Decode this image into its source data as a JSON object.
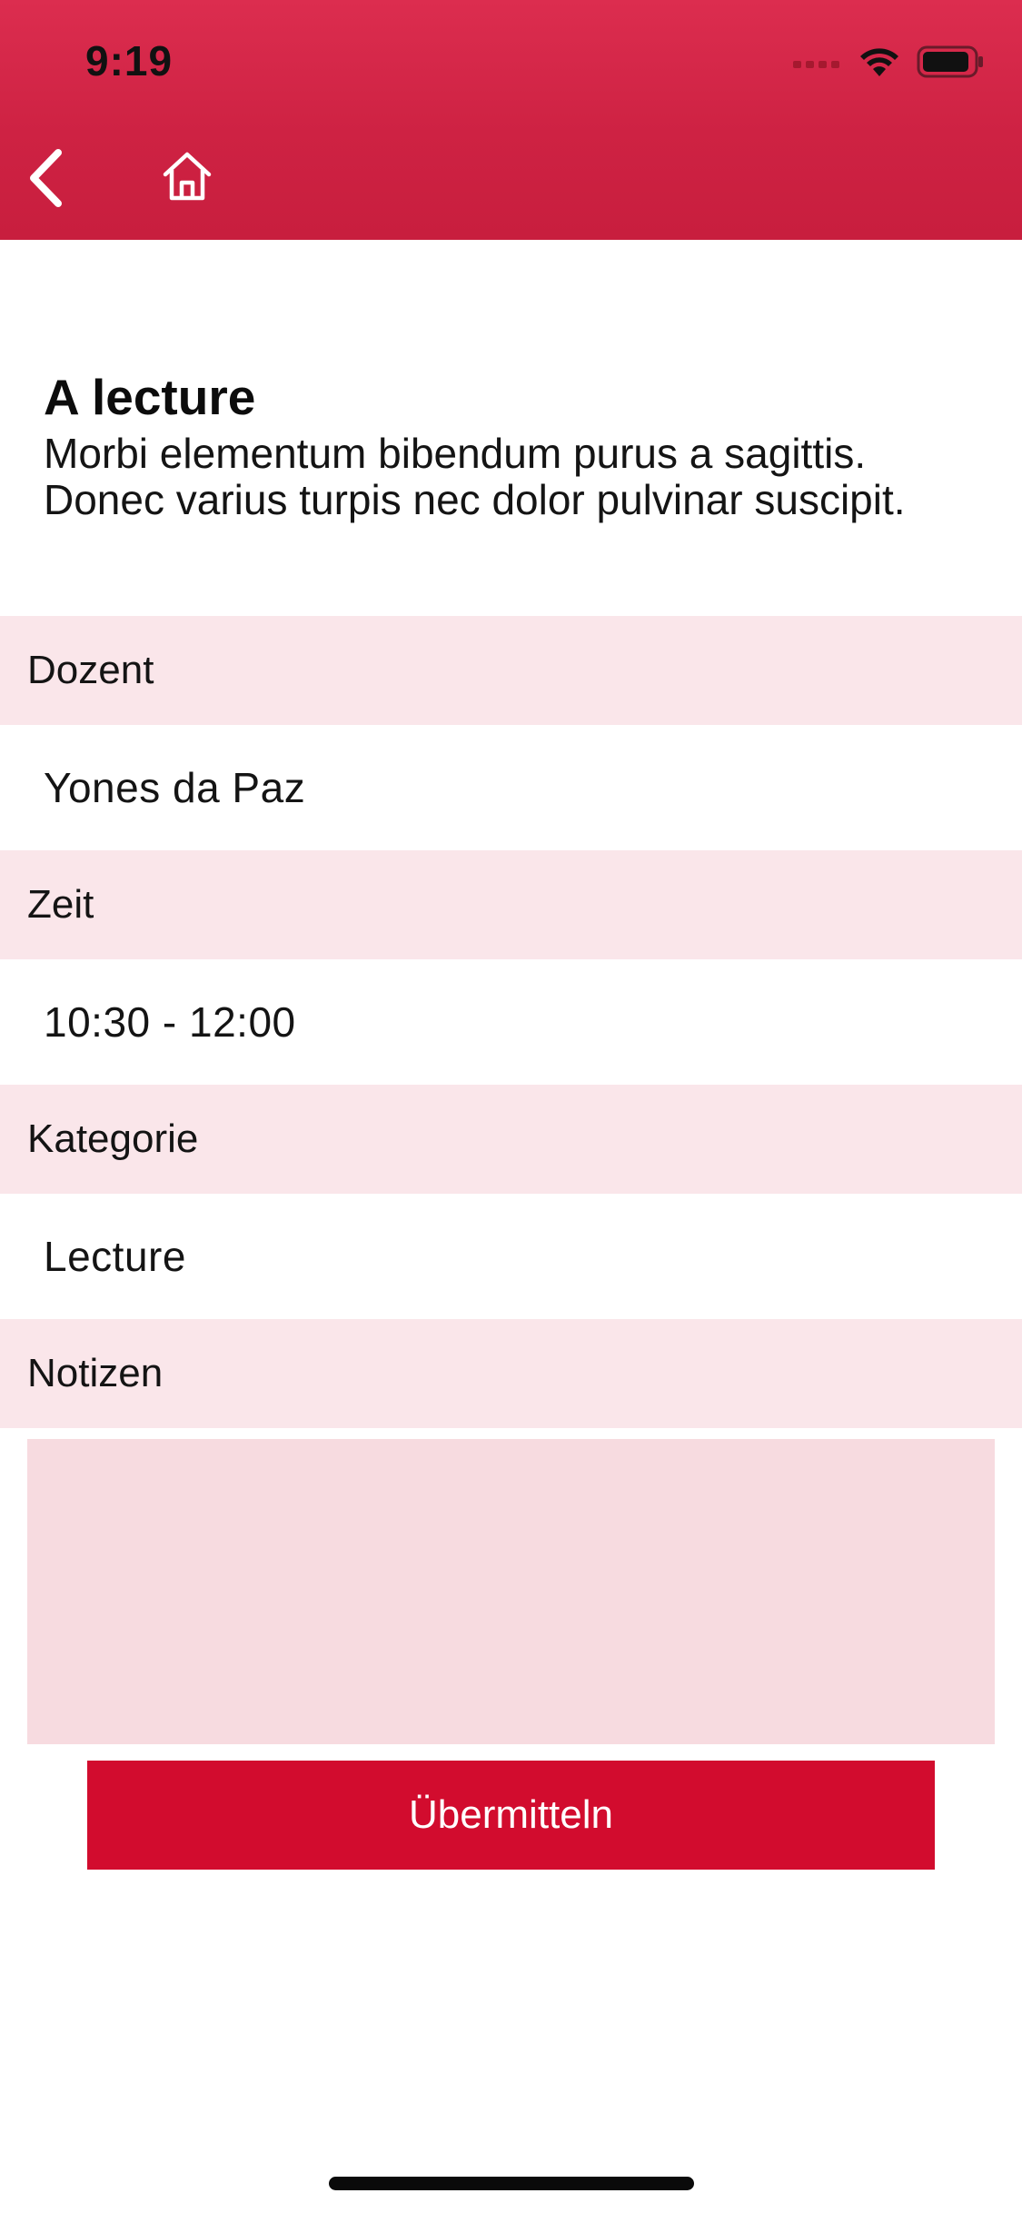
{
  "status_bar": {
    "time": "9:19",
    "icons": [
      "cellular-signal-icon",
      "wifi-icon",
      "battery-icon"
    ]
  },
  "nav": {
    "back_icon": "chevron-left-icon",
    "home_icon": "home-icon"
  },
  "lecture": {
    "title": "A lecture",
    "description": "Morbi elementum bibendum purus a sagittis. Donec varius turpis nec dolor pulvinar suscipit."
  },
  "sections": {
    "lecturer": {
      "label": "Dozent",
      "value": "Yones da Paz"
    },
    "time": {
      "label": "Zeit",
      "value": "10:30 - 12:00"
    },
    "category": {
      "label": "Kategorie",
      "value": "Lecture"
    },
    "notes": {
      "label": "Notizen",
      "value": ""
    }
  },
  "actions": {
    "submit_label": "Übermitteln"
  },
  "colors": {
    "header": "#cf2445",
    "section_bg": "#fae6ea",
    "notes_bg": "#f7dbe0",
    "button": "#d20c2e"
  }
}
